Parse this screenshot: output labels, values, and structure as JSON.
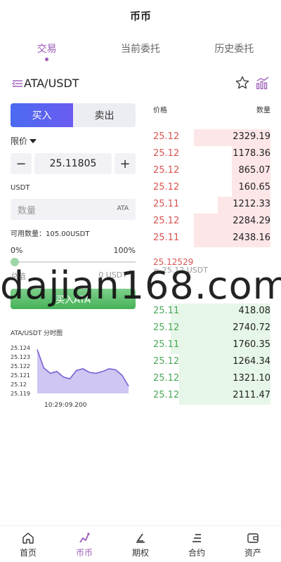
{
  "header": {
    "title": "币币"
  },
  "tabs": [
    {
      "label": "交易",
      "active": true
    },
    {
      "label": "当前委托",
      "active": false
    },
    {
      "label": "历史委托",
      "active": false
    }
  ],
  "pair": {
    "name": "ATA/USDT",
    "icons": [
      "list-toggle-icon",
      "star-icon",
      "kline-chart-icon"
    ]
  },
  "trade_form": {
    "buy_label": "买入",
    "sell_label": "卖出",
    "order_type": "限价",
    "price": "25.11805",
    "minus": "−",
    "plus": "+",
    "unit_label": "USDT",
    "amount_placeholder": "数量",
    "amount_unit": "ATA",
    "available": "可用数量：105.00USDT",
    "pct_min": "0%",
    "pct_max": "100%",
    "slider_fraction": 0.0,
    "total_label": "总值",
    "total_value": "0 USDT",
    "submit_label": "买入ATA"
  },
  "mini_chart": {
    "title": "ATA/USDT 分时图",
    "time_label": "10:29:09.200"
  },
  "chart_data": {
    "type": "area",
    "title": "ATA/USDT 分时图",
    "xlabel": "10:29:09.200",
    "ylabel": "",
    "y_ticks": [
      "25.124",
      "25.123",
      "25.122",
      "25.121",
      "25.12",
      "25.119"
    ],
    "ylim": [
      25.119,
      25.124
    ],
    "series": [
      {
        "values": [
          25.1238,
          25.1218,
          25.1212,
          25.1214,
          25.1208,
          25.1206,
          25.1215,
          25.1217,
          25.1213,
          25.1212,
          25.1214,
          25.1217,
          25.1216,
          25.121,
          25.1198
        ]
      }
    ],
    "color": "#7b5fd3",
    "fill": "#cfc6f3"
  },
  "orderbook": {
    "price_header": "价格",
    "qty_header": "数量",
    "asks": [
      {
        "price": "25.12",
        "qty": "2329.19",
        "depth": 0.65
      },
      {
        "price": "25.12",
        "qty": "1178.36",
        "depth": 0.33
      },
      {
        "price": "25.12",
        "qty": "865.07",
        "depth": 0.33
      },
      {
        "price": "25.12",
        "qty": "160.65",
        "depth": 0.33
      },
      {
        "price": "25.11",
        "qty": "1212.33",
        "depth": 0.45
      },
      {
        "price": "25.12",
        "qty": "2284.29",
        "depth": 0.65
      },
      {
        "price": "25.11",
        "qty": "2438.16",
        "depth": 0.65
      }
    ],
    "last_price": "25.12529",
    "last_price_sub": "≈ 25.12 USDT",
    "bids": [
      {
        "price": "25.11",
        "qty": "418.08",
        "depth": 0.85
      },
      {
        "price": "25.12",
        "qty": "2740.72",
        "depth": 0.85
      },
      {
        "price": "25.11",
        "qty": "1760.35",
        "depth": 0.85
      },
      {
        "price": "25.12",
        "qty": "1264.34",
        "depth": 0.78
      },
      {
        "price": "25.12",
        "qty": "1321.10",
        "depth": 0.78
      },
      {
        "price": "25.12",
        "qty": "2111.47",
        "depth": 0.78
      }
    ]
  },
  "watermark": "dajian168.com",
  "bottom_nav": [
    {
      "label": "首页",
      "icon": "home-icon",
      "active": false
    },
    {
      "label": "币币",
      "icon": "coin-trade-icon",
      "active": true
    },
    {
      "label": "期权",
      "icon": "options-icon",
      "active": false
    },
    {
      "label": "合约",
      "icon": "contract-icon",
      "active": false
    },
    {
      "label": "资产",
      "icon": "wallet-icon",
      "active": false
    }
  ]
}
